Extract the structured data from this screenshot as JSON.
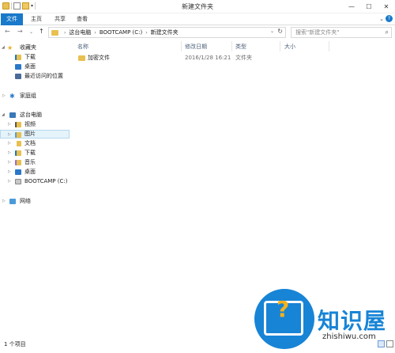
{
  "window": {
    "title": "新建文件夹",
    "minimize_glyph": "—",
    "maximize_glyph": "☐",
    "close_glyph": "✕"
  },
  "ribbon": {
    "tabs": [
      {
        "label": "文件",
        "active": true
      },
      {
        "label": "主页"
      },
      {
        "label": "共享"
      },
      {
        "label": "查看"
      }
    ],
    "expand_glyph": "⌄",
    "help_glyph": "?"
  },
  "navigation": {
    "back_glyph": "←",
    "forward_glyph": "→",
    "recent_glyph": "⌄",
    "up_glyph": "↑",
    "breadcrumbs": [
      "这台电脑",
      "BOOTCAMP (C:)",
      "新建文件夹"
    ],
    "crumb_separator": "›",
    "dropdown_glyph": "⌄",
    "refresh_glyph": "↻"
  },
  "search": {
    "placeholder": "搜索\"新建文件夹\"",
    "icon": "search-icon"
  },
  "sidebar": {
    "favorites": {
      "label": "收藏夹",
      "icon": "star-icon"
    },
    "favorite_items": [
      {
        "label": "下载",
        "icon": "downloads-folder-icon"
      },
      {
        "label": "桌面",
        "icon": "desktop-icon"
      },
      {
        "label": "最近访问的位置",
        "icon": "recent-places-icon"
      }
    ],
    "homegroup": {
      "label": "家庭组",
      "icon": "homegroup-icon"
    },
    "this_pc": {
      "label": "这台电脑",
      "icon": "computer-icon"
    },
    "pc_items": [
      {
        "label": "视频",
        "icon": "videos-folder-icon"
      },
      {
        "label": "图片",
        "icon": "pictures-folder-icon",
        "selected": true
      },
      {
        "label": "文档",
        "icon": "documents-folder-icon"
      },
      {
        "label": "下载",
        "icon": "downloads-folder-icon"
      },
      {
        "label": "音乐",
        "icon": "music-folder-icon"
      },
      {
        "label": "桌面",
        "icon": "desktop-icon"
      },
      {
        "label": "BOOTCAMP (C:)",
        "icon": "drive-icon"
      }
    ],
    "network": {
      "label": "网络",
      "icon": "network-icon"
    }
  },
  "columns": {
    "name": "名称",
    "modified": "修改日期",
    "type": "类型",
    "size": "大小"
  },
  "files": [
    {
      "name": "加密文件",
      "modified": "2016/1/28 16:21",
      "type": "文件夹",
      "size": ""
    }
  ],
  "status": {
    "item_count": "1 个项目"
  },
  "watermark": {
    "brand": "知识屋",
    "domain": "zhishiwu.com",
    "accent": "#1784d6",
    "highlight": "#f6b21b"
  }
}
